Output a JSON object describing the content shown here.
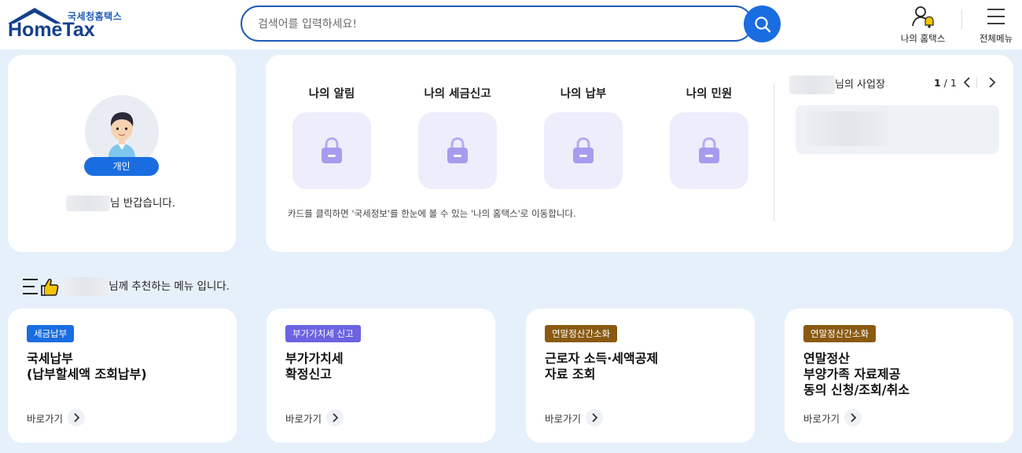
{
  "header": {
    "logo_sub": "국세청홈택스",
    "logo_main": "HomeTax",
    "search_placeholder": "검색어를 입력하세요!",
    "my_hometax_label": "나의 홈택스",
    "all_menu_label": "전체메뉴"
  },
  "profile": {
    "type_badge": "개인",
    "greeting_suffix": "님 반갑습니다."
  },
  "main": {
    "tiles": [
      {
        "label": "나의 알림"
      },
      {
        "label": "나의 세금신고"
      },
      {
        "label": "나의 납부"
      },
      {
        "label": "나의 민원"
      }
    ],
    "note": "카드를 클릭하면 '국세정보'를 한눈에 볼 수 있는 '나의 홈택스'로 이동합니다.",
    "business_suffix": "님의 사업장",
    "pager_current": "1",
    "pager_sep": " / ",
    "pager_total": "1"
  },
  "recommend": {
    "heading_suffix": "님께 추천하는 메뉴 입니다.",
    "cards": [
      {
        "tag": "세금납부",
        "tag_color": "#1a6de0",
        "title": "국세납부\n(납부할세액 조회납부)",
        "go": "바로가기"
      },
      {
        "tag": "부가가치세 신고",
        "tag_color": "#6b63e0",
        "title": "부가가치세\n확정신고",
        "go": "바로가기"
      },
      {
        "tag": "연말정산간소화",
        "tag_color": "#8a5a12",
        "title": "근로자 소득·세액공제\n자료 조회",
        "go": "바로가기"
      },
      {
        "tag": "연말정산간소화",
        "tag_color": "#8a5a12",
        "title": "연말정산\n부양가족 자료제공\n동의 신청/조회/취소",
        "go": "바로가기"
      }
    ]
  }
}
